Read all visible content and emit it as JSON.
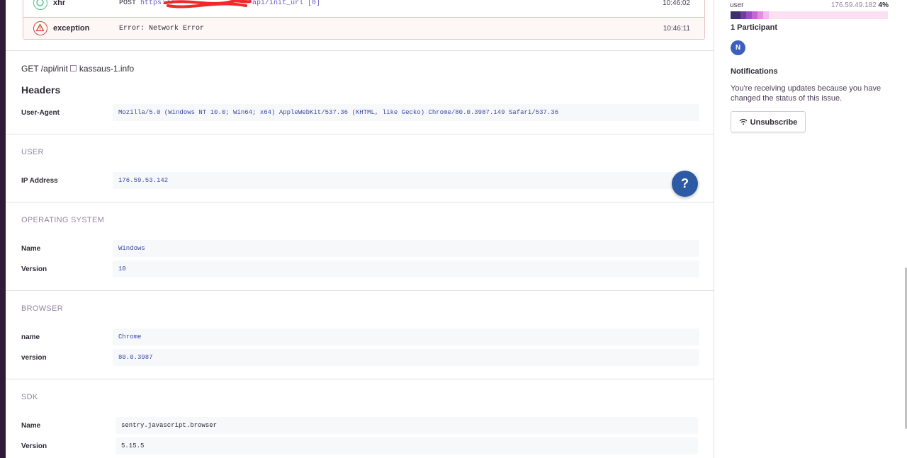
{
  "breadcrumbs": [
    {
      "type": "xhr",
      "method": "POST",
      "url_start": "https://",
      "url_end": "api/init_url [0]",
      "time": "10:46:02"
    },
    {
      "type": "exception",
      "message": "Error: Network Error",
      "time": "10:46:11"
    }
  ],
  "request": {
    "method": "GET",
    "path": "/api/init",
    "host": "kassaus-1.info",
    "headers_title": "Headers",
    "headers": [
      {
        "key": "User-Agent",
        "value": "Mozilla/5.0 (Windows NT 10.0; Win64; x64) AppleWebKit/537.36 (KHTML, like Gecko) Chrome/80.0.3987.149 Safari/537.36"
      }
    ]
  },
  "sections": {
    "user": {
      "title": "USER",
      "rows": [
        {
          "key": "IP Address",
          "value": "176.59.53.142"
        }
      ]
    },
    "os": {
      "title": "OPERATING SYSTEM",
      "rows": [
        {
          "key": "Name",
          "value": "Windows"
        },
        {
          "key": "Version",
          "value": "10"
        }
      ]
    },
    "browser": {
      "title": "BROWSER",
      "rows": [
        {
          "key": "name",
          "value": "Chrome"
        },
        {
          "key": "version",
          "value": "80.0.3987"
        }
      ]
    },
    "sdk": {
      "title": "SDK",
      "rows": [
        {
          "key": "Name",
          "value": "sentry.javascript.browser"
        },
        {
          "key": "Version",
          "value": "5.15.5"
        }
      ]
    }
  },
  "help_label": "?",
  "sidebar": {
    "tag_name": "user",
    "tag_value": "176.59.49.182",
    "tag_percent": "4%",
    "bar_colors": [
      "#3d2f6b",
      "#6b3f9a",
      "#9b4fc0",
      "#c467d4",
      "#e28ee0",
      "#f2b9ec"
    ],
    "participants": "1 Participant",
    "avatar_initial": "N",
    "notifications_title": "Notifications",
    "notifications_text": "You're receiving updates because you have changed the status of this issue.",
    "unsubscribe_label": "Unsubscribe"
  },
  "colors": {
    "accent": "#6c5fc7",
    "error": "#e03e2f",
    "help": "#2d5aa5"
  }
}
